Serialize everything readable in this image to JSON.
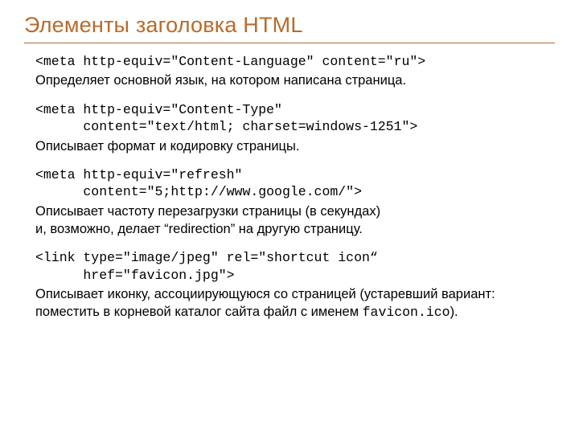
{
  "title": "Элементы заголовка HTML",
  "blocks": [
    {
      "code": "<meta http-equiv=\"Content-Language\" content=\"ru\">",
      "desc": "Определяет основной язык, на котором написана страница."
    },
    {
      "code": "<meta http-equiv=\"Content-Type\"\n      content=\"text/html; charset=windows-1251\">",
      "desc": "Описывает формат и кодировку страницы."
    },
    {
      "code": "<meta http-equiv=\"refresh\"\n      content=\"5;http://www.google.com/\">",
      "desc": "Описывает частоту перезагрузки страницы (в секундах)\nи, возможно, делает “redirection” на другую страницу."
    },
    {
      "code": "<link type=\"image/jpeg\" rel=\"shortcut icon“\n      href=\"favicon.jpg\">",
      "desc_prefix": "Описывает иконку, ассоциирующуюся со страницей (устаревший вариант: поместить в корневой каталог сайта файл с именем ",
      "desc_mono": "favicon.ico",
      "desc_suffix": ")."
    }
  ]
}
